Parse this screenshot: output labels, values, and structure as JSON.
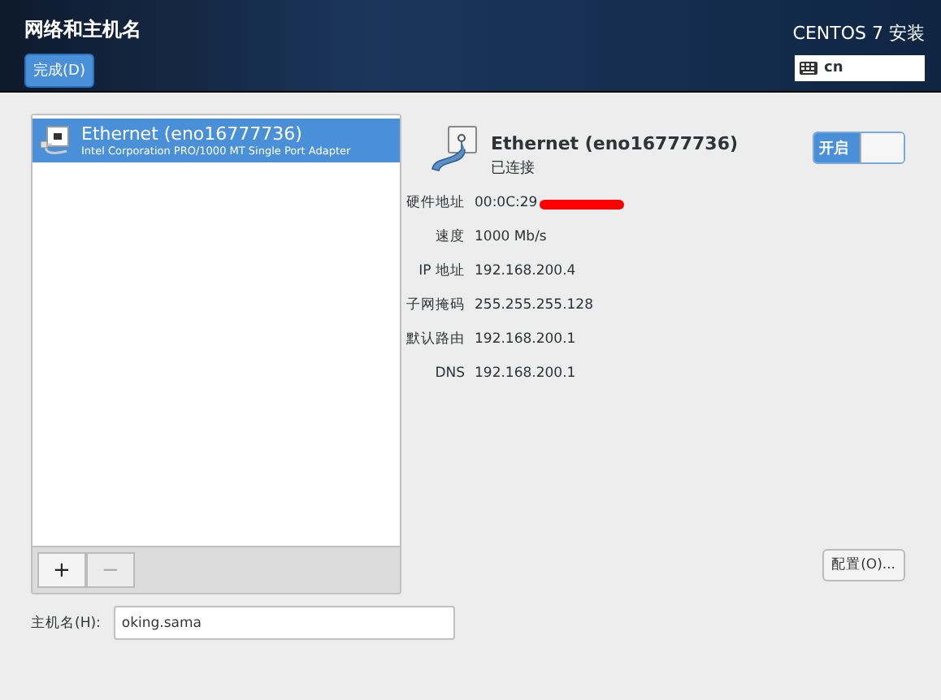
{
  "header": {
    "title": "网络和主机名",
    "done_button": "完成(D)",
    "product": "CENTOS 7 安装",
    "keyboard_layout": "cn"
  },
  "devices": [
    {
      "name": "Ethernet (eno16777736)",
      "description": "Intel Corporation PRO/1000 MT Single Port Adapter",
      "selected": true
    }
  ],
  "list_toolbar": [
    {
      "label": "+",
      "disabled": false
    },
    {
      "label": "−",
      "disabled": true
    }
  ],
  "detail": {
    "name": "Ethernet (eno16777736)",
    "status": "已连接",
    "switch": {
      "label": "开启",
      "on": true
    },
    "fields": [
      {
        "label": "硬件地址",
        "value": "00:0C:29",
        "redacted": true
      },
      {
        "label": "速度",
        "value": "1000 Mb/s",
        "redacted": false
      },
      {
        "label": "IP 地址",
        "value": "192.168.200.4",
        "redacted": false
      },
      {
        "label": "子网掩码",
        "value": "255.255.255.128",
        "redacted": false
      },
      {
        "label": "默认路由",
        "value": "192.168.200.1",
        "redacted": false
      },
      {
        "label": "DNS",
        "value": "192.168.200.1",
        "redacted": false
      }
    ],
    "configure_button": "配置(O)..."
  },
  "hostname": {
    "label": "主机名(H):",
    "value": "oking.sama"
  }
}
